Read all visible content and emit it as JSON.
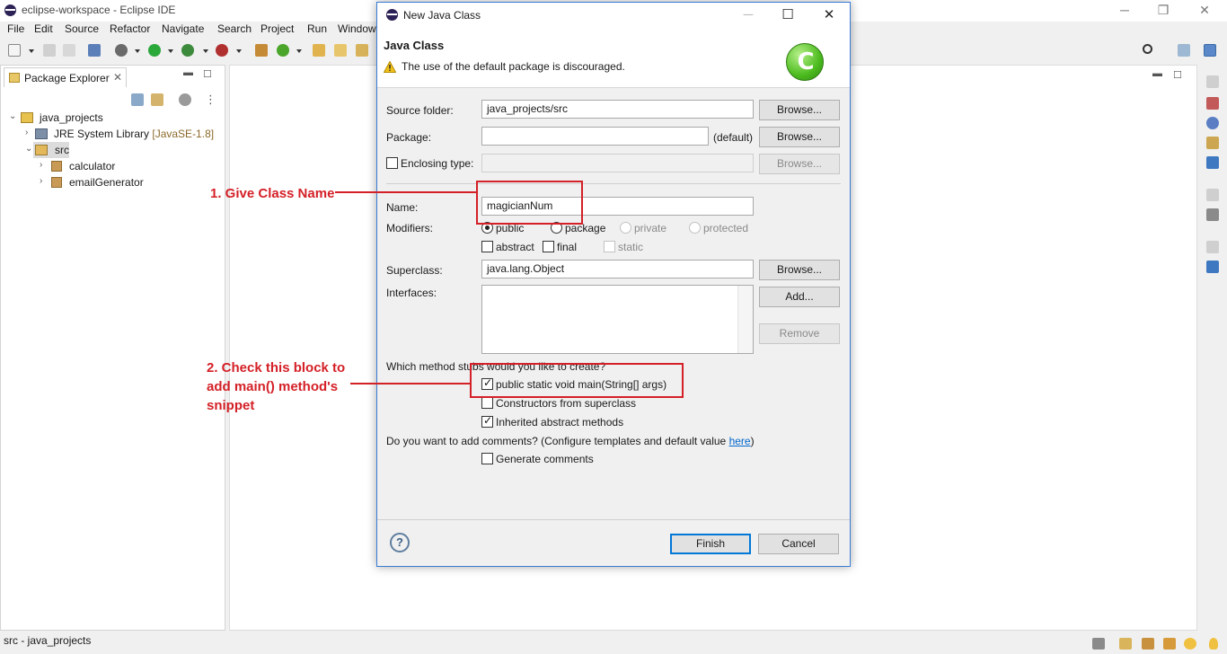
{
  "window": {
    "title": "eclipse-workspace - Eclipse IDE"
  },
  "menu": [
    "File",
    "Edit",
    "Source",
    "Refactor",
    "Navigate",
    "Search",
    "Project",
    "Run",
    "Window"
  ],
  "package_explorer": {
    "tab_label": "Package Explorer",
    "tree": {
      "project": "java_projects",
      "jre_label": "JRE System Library",
      "jre_decoration": "[JavaSE-1.8]",
      "src": "src",
      "packages": [
        "calculator",
        "emailGenerator"
      ]
    }
  },
  "status_bar": {
    "text": "src - java_projects"
  },
  "dialog": {
    "title": "New Java Class",
    "header_title": "Java Class",
    "warning": "The use of the default package is discouraged.",
    "source_folder_label": "Source folder:",
    "source_folder_value": "java_projects/src",
    "package_label": "Package:",
    "package_value": "",
    "package_default": "(default)",
    "enclosing_type_label": "Enclosing type:",
    "name_label": "Name:",
    "name_value": "magicianNum",
    "modifiers_label": "Modifiers:",
    "modifiers": {
      "public": "public",
      "package": "package",
      "private": "private",
      "protected": "protected",
      "abstract": "abstract",
      "final": "final",
      "static": "static"
    },
    "superclass_label": "Superclass:",
    "superclass_value": "java.lang.Object",
    "interfaces_label": "Interfaces:",
    "browse_label": "Browse...",
    "add_label": "Add...",
    "remove_label": "Remove",
    "stubs_question": "Which method stubs would you like to create?",
    "stub_main": "public static void main(String[] args)",
    "stub_constructors": "Constructors from superclass",
    "stub_inherited": "Inherited abstract methods",
    "comments_question": "Do you want to add comments? (Configure templates and default value ",
    "comments_link": "here",
    "comments_close": ")",
    "generate_comments": "Generate comments",
    "help_label": "?",
    "finish_label": "Finish",
    "cancel_label": "Cancel"
  },
  "annotations": {
    "step1": "1. Give Class Name",
    "step2_line1": "2. Check this block to",
    "step2_line2": "add main() method's",
    "step2_line3": "snippet"
  }
}
